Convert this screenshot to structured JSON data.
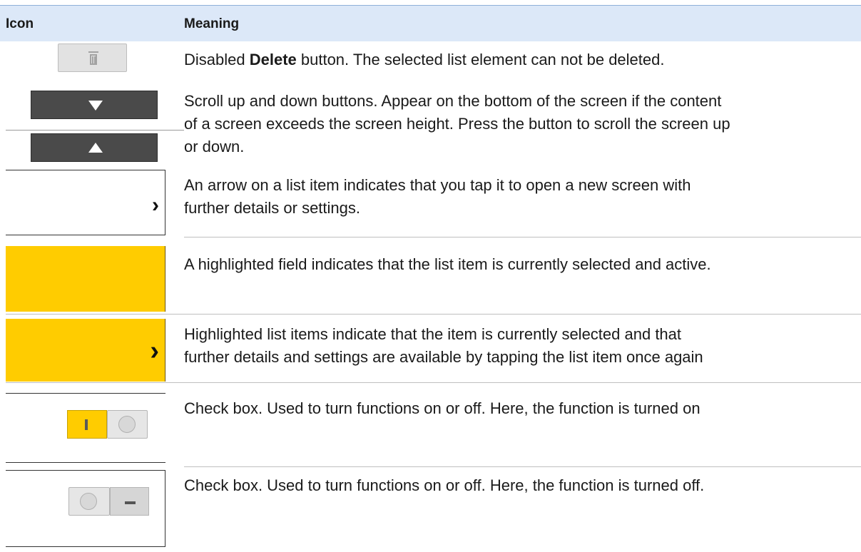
{
  "table": {
    "headers": {
      "icon": "Icon",
      "meaning": "Meaning"
    },
    "rows": [
      {
        "meaning_bold": "Delete",
        "meaning_pre": "Disabled ",
        "meaning_post": " button. The selected list element can not be deleted."
      },
      {
        "line1": "Scroll up and down buttons. Appear on the bottom of the screen if the content",
        "line2": "of a screen exceeds the screen height. Press the button to scroll the screen up",
        "line3": "or down."
      },
      {
        "line1": "An arrow on a list item indicates that you tap it to open a new screen with",
        "line2": "further details or settings."
      },
      {
        "line1": "A highlighted field indicates that the list item is currently selected and active."
      },
      {
        "line1": "Highlighted list items indicate that the item is currently selected and that",
        "line2": "further details and settings are available by tapping the list item once again"
      },
      {
        "line1": "Check box. Used to turn functions on or off. Here, the function is turned on"
      },
      {
        "line1": "Check box. Used to turn functions on or off. Here, the function is turned off."
      }
    ]
  },
  "icons": {
    "delete": "trash-icon",
    "scroll_down": "triangle-down-icon",
    "scroll_up": "triangle-up-icon",
    "chevron": "chevron-right-icon",
    "chevron_glyph": "›"
  },
  "colors": {
    "header_bg": "#dce8f8",
    "highlight": "#ffcc00",
    "dark_button": "#4a4a4a",
    "disabled_button": "#e2e2e2"
  }
}
